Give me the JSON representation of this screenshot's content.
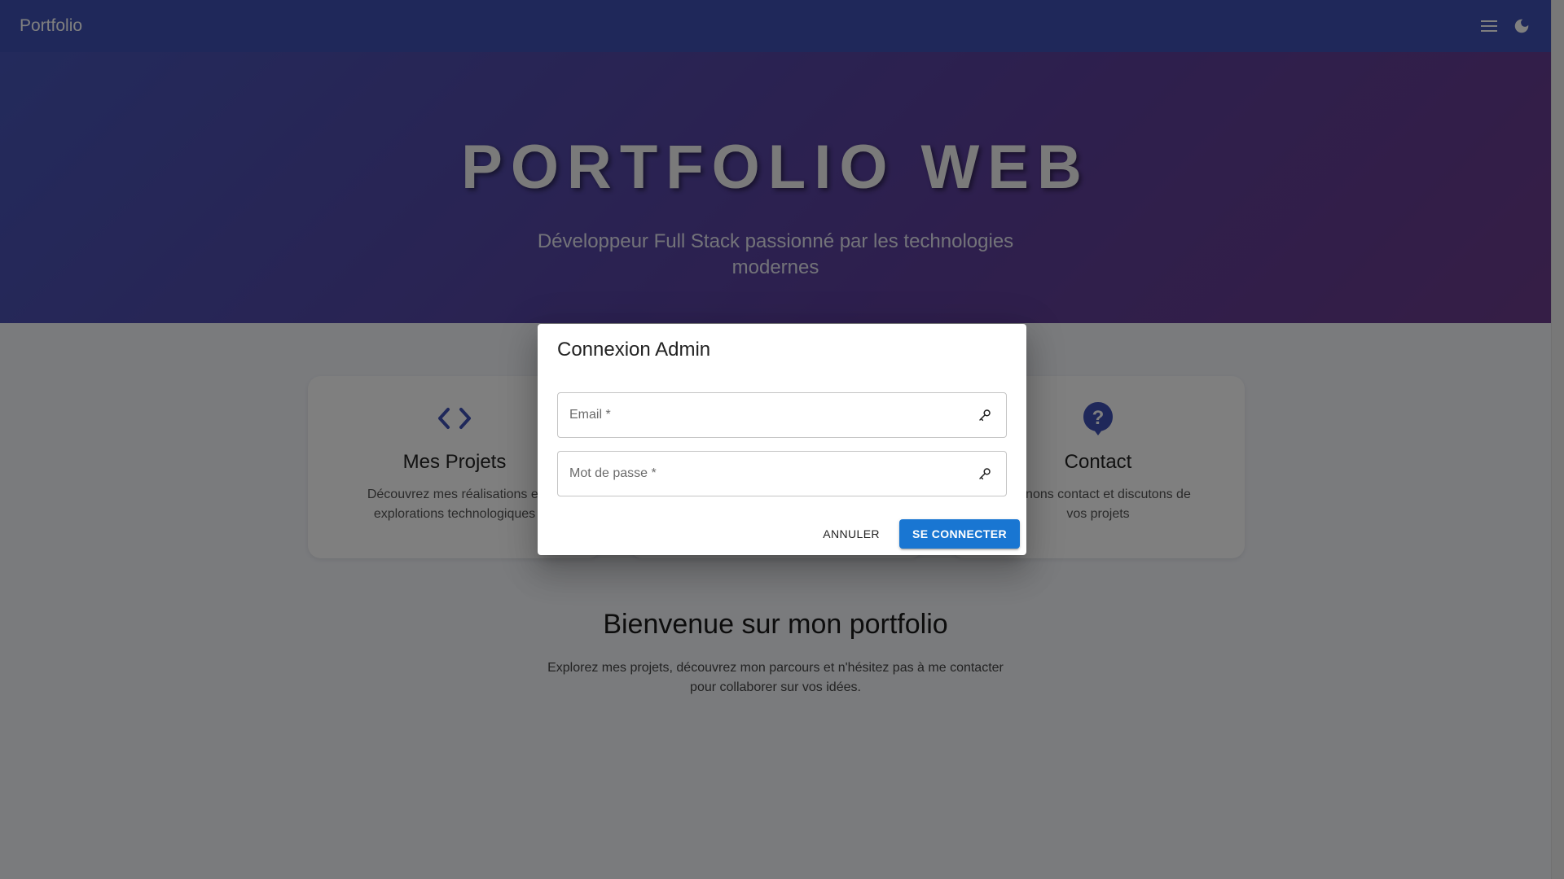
{
  "appbar": {
    "brand": "Portfolio",
    "menu_icon": "menu-icon",
    "theme_icon": "dark-mode-icon",
    "color": "#3f51b5"
  },
  "hero": {
    "title": "PORTFOLIO WEB",
    "subtitle": "Développeur Full Stack passionné par les technologies modernes"
  },
  "cards": [
    {
      "icon": "code-icon",
      "title": "Mes Projets",
      "text": "Découvrez mes réalisations et explorations technologiques"
    },
    {
      "icon": "",
      "title": "",
      "text": ""
    },
    {
      "icon": "help-icon",
      "title": "Contact",
      "text": "Prenons contact et discutons de vos projets"
    }
  ],
  "welcome": {
    "title": "Bienvenue sur mon portfolio",
    "text": "Explorez mes projets, découvrez mon parcours et n'hésitez pas à me contacter pour collaborer sur vos idées."
  },
  "dialog": {
    "title": "Connexion Admin",
    "email": {
      "placeholder": "Email *",
      "value": "",
      "icon": "key-icon"
    },
    "password": {
      "placeholder": "Mot de passe *",
      "value": "",
      "icon": "key-icon"
    },
    "cancel_label": "ANNULER",
    "submit_label": "SE CONNECTER",
    "accent": "#1976d2"
  }
}
